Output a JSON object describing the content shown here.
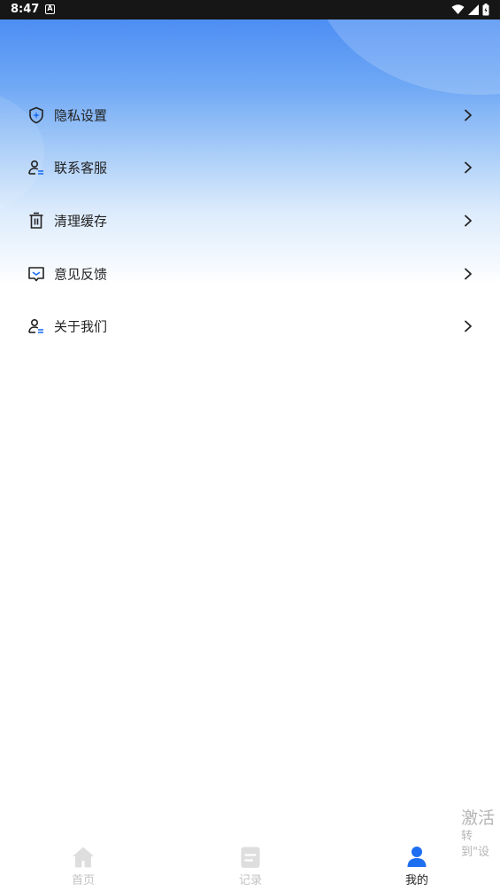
{
  "status_bar": {
    "time": "8:47",
    "notification_glyph": "A"
  },
  "menu": {
    "items": [
      {
        "label": "隐私设置",
        "icon": "shield-icon"
      },
      {
        "label": "联系客服",
        "icon": "user-list-icon"
      },
      {
        "label": "清理缓存",
        "icon": "trash-icon"
      },
      {
        "label": "意见反馈",
        "icon": "feedback-message-icon"
      },
      {
        "label": "关于我们",
        "icon": "user-list-icon"
      }
    ]
  },
  "watermark": {
    "title": "激活",
    "subtitle": "转到\"设"
  },
  "tabbar": {
    "tabs": [
      {
        "label": "首页",
        "icon": "home-icon",
        "active": false
      },
      {
        "label": "记录",
        "icon": "document-icon",
        "active": false
      },
      {
        "label": "我的",
        "icon": "user-icon",
        "active": true
      }
    ]
  },
  "colors": {
    "accent": "#1e6ef2",
    "hero_top": "#4d8ef3",
    "tab_inactive": "#c2c2c2"
  }
}
